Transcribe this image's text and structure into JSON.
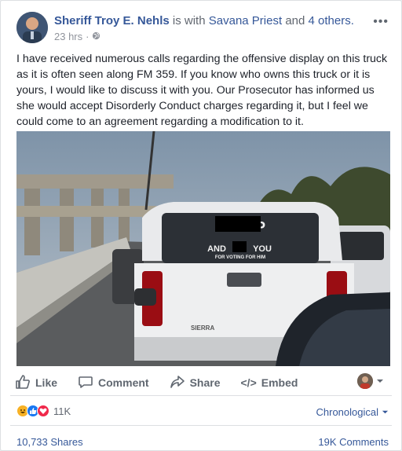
{
  "post": {
    "author": "Sheriff Troy E. Nehls",
    "with_text": "is with",
    "tagged_person": "Savana Priest",
    "and_text": "and",
    "others": "4 others.",
    "time": "23 hrs",
    "privacy_separator": "·",
    "privacy_icon": "globe-icon",
    "more_icon": "ellipsis-icon",
    "body": "I have received numerous calls regarding the offensive display on this truck as it is often seen along FM 359. If you know who owns this truck or it is yours, I would like to discuss it with you. Our Prosecutor has informed us she would accept Disorderly Conduct charges regarding it, but I feel we could come to an agreement regarding a modification to it."
  },
  "photo": {
    "window_text_line1": "TRUMP",
    "window_text_line2": "AND",
    "window_text_line3": "YOU",
    "window_text_line4": "FOR VOTING FOR HIM",
    "tailgate_badge": "SIERRA"
  },
  "actions": {
    "like": "Like",
    "comment": "Comment",
    "share": "Share",
    "embed": "Embed",
    "embed_glyph": "</>",
    "dropdown_icon": "caret-down-icon"
  },
  "stats": {
    "reaction_count": "11K",
    "reactions": [
      "haha",
      "like",
      "love"
    ],
    "order_label": "Chronological",
    "shares": "10,733 Shares",
    "comments": "19K Comments"
  },
  "colors": {
    "link": "#365899",
    "muted": "#90949c",
    "action": "#606770",
    "like_blue": "#1877f2",
    "love_red": "#f0284a",
    "haha_yellow": "#f7b125"
  }
}
